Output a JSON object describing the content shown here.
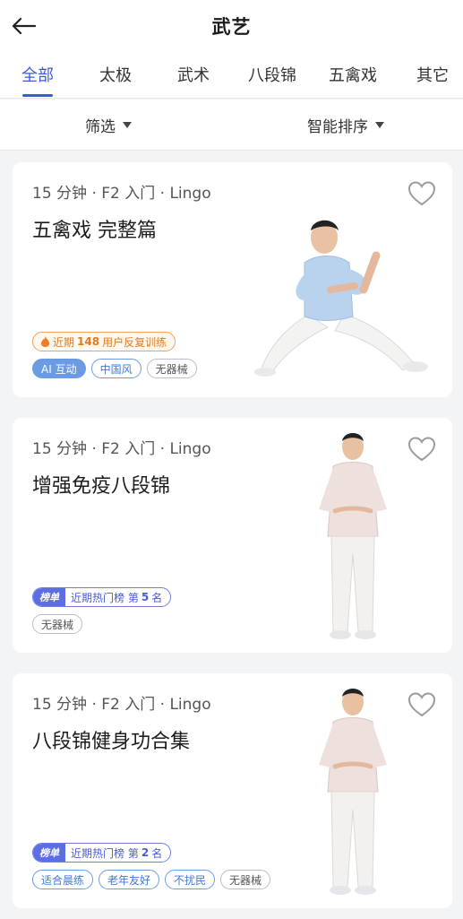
{
  "header": {
    "title": "武艺"
  },
  "tabs": [
    "全部",
    "太极",
    "武术",
    "八段锦",
    "五禽戏",
    "其它"
  ],
  "filters": {
    "filter_label": "筛选",
    "sort_label": "智能排序"
  },
  "cards": [
    {
      "meta": "15 分钟 · F2 入门 · Lingo",
      "title": "五禽戏 完整篇",
      "hot": {
        "prefix": "近期",
        "count": "148",
        "suffix": "用户反复训练"
      },
      "tags": [
        "AI 互动",
        "中国风",
        "无器械"
      ],
      "favorite": false
    },
    {
      "meta": "15 分钟 · F2 入门 · Lingo",
      "title": "增强免疫八段锦",
      "rank": {
        "tag": "榜单",
        "prefix": "近期热门榜 第",
        "num": "5",
        "suffix": "名"
      },
      "tags": [
        "无器械"
      ],
      "favorite": false
    },
    {
      "meta": "15 分钟 · F2 入门 · Lingo",
      "title": "八段锦健身功合集",
      "rank": {
        "tag": "榜单",
        "prefix": "近期热门榜 第",
        "num": "2",
        "suffix": "名"
      },
      "tags": [
        "适合晨练",
        "老年友好",
        "不扰民",
        "无器械"
      ],
      "favorite": false
    }
  ],
  "colors": {
    "accent": "#3b5bd6",
    "background": "#f3f4f6"
  }
}
